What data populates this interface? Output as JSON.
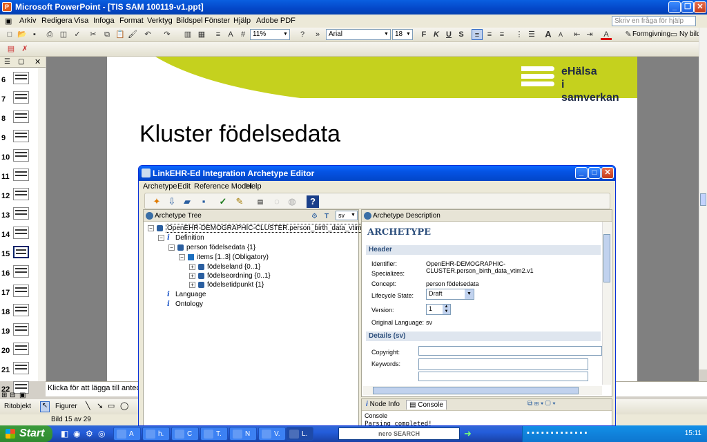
{
  "window": {
    "title": "Microsoft PowerPoint - [TIS SAM 100119-v1.ppt]",
    "app_icon": "P"
  },
  "menu": {
    "items": [
      "Arkiv",
      "Redigera",
      "Visa",
      "Infoga",
      "Format",
      "Verktyg",
      "Bildspel",
      "Fönster",
      "Hjälp",
      "Adobe PDF"
    ],
    "help_placeholder": "Skriv en fråga för hjälp"
  },
  "toolbar": {
    "zoom": "11%",
    "font": "Arial",
    "font_size": "18",
    "formgivning": "Formgivning",
    "ny_bild": "Ny bild"
  },
  "slides": {
    "numbers": [
      "6",
      "7",
      "8",
      "9",
      "10",
      "11",
      "12",
      "13",
      "14",
      "15",
      "16",
      "17",
      "18",
      "19",
      "20",
      "21",
      "22"
    ],
    "selected": "15"
  },
  "slide": {
    "title": "Kluster födelsedata",
    "logo_line1": "eHälsa",
    "logo_line2": "i samverkan",
    "accent": "#c5d11e"
  },
  "notes": {
    "placeholder": "Klicka för att lägga till anteck"
  },
  "drawbar": {
    "ritobjekt": "Ritobjekt",
    "figurer": "Figurer"
  },
  "status": {
    "slide_info": "Bild 15 av 29"
  },
  "taskbar": {
    "start": "Start",
    "tasks": [
      "A",
      "h.",
      "C",
      "T.",
      "N",
      "V.",
      "L."
    ],
    "nero": "nero SEARCH",
    "clock": "15:11"
  },
  "dialog": {
    "title": "LinkEHR-Ed Integration Archetype Editor",
    "menu": [
      "Archetype",
      "Edit",
      "Reference Model",
      "Help"
    ],
    "tree_header": "Archetype Tree",
    "lang": "sv",
    "tree": {
      "root": "OpenEHR-DEMOGRAPHIC-CLUSTER.person_birth_data_vtim2.v1",
      "definition": "Definition",
      "cluster": "person födelsedata {1}",
      "items": "items [1..3] (Obligatory)",
      "fields": [
        "födelseland {0..1}",
        "födelseordning {0..1}",
        "födelsetidpunkt {1}"
      ],
      "language": "Language",
      "ontology": "Ontology"
    },
    "desc_header": "Archetype Description",
    "heading": "ARCHETYPE",
    "header_section": "Header",
    "identifier_label": "Identifier:",
    "identifier": "OpenEHR-DEMOGRAPHIC-CLUSTER.person_birth_data_vtim2.v1",
    "specializes_label": "Specializes:",
    "concept_label": "Concept:",
    "concept": "person födelsedata",
    "lifecycle_label": "Lifecycle State:",
    "lifecycle": "Draft",
    "version_label": "Version:",
    "version": "1",
    "origlang_label": "Original Language:",
    "origlang": "sv",
    "details_section": "Details (sv)",
    "copyright_label": "Copyright:",
    "keywords_label": "Keywords:",
    "tab_nodeinfo": "Node Info",
    "tab_console": "Console",
    "console_label": "Console",
    "console_text": "Parsing completed!"
  }
}
